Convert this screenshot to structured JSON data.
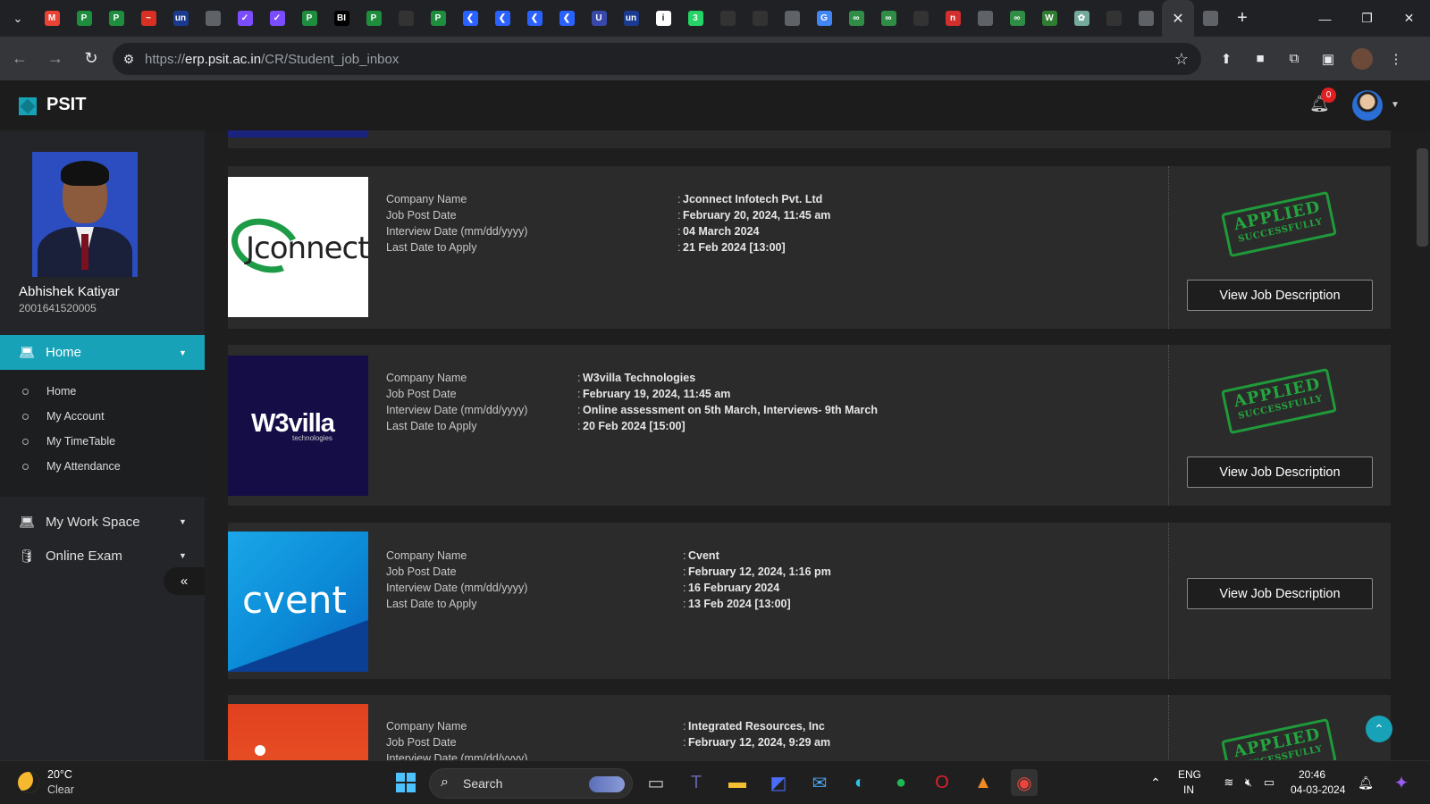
{
  "browser": {
    "tab_icons": [
      {
        "icon": "gmail-icon",
        "color": "#ea4335",
        "label": "M"
      },
      {
        "icon": "erp-icon",
        "color": "#1e8e3e",
        "label": "P"
      },
      {
        "icon": "erp-icon",
        "color": "#1e8e3e",
        "label": "P"
      },
      {
        "icon": "red-swoosh-icon",
        "color": "#d93025",
        "label": "~"
      },
      {
        "icon": "unstop-icon",
        "color": "#1a3a8f",
        "label": "un"
      },
      {
        "icon": "globe-icon",
        "color": "#5f6368",
        "label": ""
      },
      {
        "icon": "checkmark-icon",
        "color": "#7c4dff",
        "label": "✓"
      },
      {
        "icon": "checkmark-icon",
        "color": "#7c4dff",
        "label": "✓"
      },
      {
        "icon": "erp-icon",
        "color": "#1e8e3e",
        "label": "P"
      },
      {
        "icon": "bi-icon",
        "color": "#000000",
        "label": "BI"
      },
      {
        "icon": "erp-icon",
        "color": "#1e8e3e",
        "label": "P"
      },
      {
        "icon": "github-icon",
        "color": "#333333",
        "label": ""
      },
      {
        "icon": "erp-icon",
        "color": "#1e8e3e",
        "label": "P"
      },
      {
        "icon": "chevron-icon",
        "color": "#2962ff",
        "label": "❮"
      },
      {
        "icon": "chevron-icon",
        "color": "#2962ff",
        "label": "❮"
      },
      {
        "icon": "chevron-icon",
        "color": "#2962ff",
        "label": "❮"
      },
      {
        "icon": "chevron-icon",
        "color": "#2962ff",
        "label": "❮"
      },
      {
        "icon": "bucket-icon",
        "color": "#3949ab",
        "label": "U"
      },
      {
        "icon": "unstop-icon",
        "color": "#1a3a8f",
        "label": "un"
      },
      {
        "icon": "info-icon",
        "color": "#ffffff",
        "label": "i"
      },
      {
        "icon": "whatsapp-icon",
        "color": "#25d366",
        "label": "3"
      },
      {
        "icon": "github-icon",
        "color": "#333333",
        "label": ""
      },
      {
        "icon": "github-icon",
        "color": "#333333",
        "label": ""
      },
      {
        "icon": "globe-icon",
        "color": "#5f6368",
        "label": ""
      },
      {
        "icon": "google-icon",
        "color": "#4285f4",
        "label": "G"
      },
      {
        "icon": "gfg-icon",
        "color": "#2f8d46",
        "label": "∞"
      },
      {
        "icon": "gfg-icon",
        "color": "#2f8d46",
        "label": "∞"
      },
      {
        "icon": "github-icon",
        "color": "#333333",
        "label": ""
      },
      {
        "icon": "red-square-icon",
        "color": "#d32f2f",
        "label": "n"
      },
      {
        "icon": "globe-icon",
        "color": "#5f6368",
        "label": ""
      },
      {
        "icon": "gfg-icon",
        "color": "#2f8d46",
        "label": "∞"
      },
      {
        "icon": "w-icon",
        "color": "#2e7d32",
        "label": "W"
      },
      {
        "icon": "chatgpt-icon",
        "color": "#74aa9c",
        "label": "✿"
      },
      {
        "icon": "github-icon",
        "color": "#333333",
        "label": ""
      },
      {
        "icon": "globe-icon",
        "color": "#5f6368",
        "label": ""
      }
    ],
    "url_prefix": "https://",
    "url_host": "erp.psit.ac.in",
    "url_path": "/CR/Student_job_inbox"
  },
  "app": {
    "name": "PSIT",
    "notification_count": "0"
  },
  "profile": {
    "name": "Abhishek Katiyar",
    "id": "2001641520005"
  },
  "sidebar": {
    "home_label": "Home",
    "submenu": [
      "Home",
      "My Account",
      "My TimeTable",
      "My Attendance"
    ],
    "work_space_label": "My Work Space",
    "online_exam_label": "Online Exam"
  },
  "field_labels": {
    "company": "Company Name",
    "post_date": "Job Post Date",
    "interview": "Interview Date (mm/dd/yyyy)",
    "last_date": "Last Date to Apply"
  },
  "stamp": {
    "line1": "APPLIED",
    "line2": "SUCCESSFULLY"
  },
  "view_button_label": "View Job Description",
  "jobs": [
    {
      "company": "Jconnect Infotech Pvt. Ltd",
      "post_date": "February 20, 2024, 11:45 am",
      "interview": "04 March 2024",
      "last_date": "21 Feb 2024 [13:00]",
      "logo_text": "Jconnect",
      "applied": true
    },
    {
      "company": "W3villa Technologies",
      "post_date": "February 19, 2024, 11:45 am",
      "interview": "Online assessment on 5th March, Interviews- 9th March",
      "last_date": "20 Feb 2024 [15:00]",
      "logo_text": "W3villa",
      "logo_sub": "technologies",
      "applied": true
    },
    {
      "company": "Cvent",
      "post_date": "February 12, 2024, 1:16 pm",
      "interview": "16 February 2024",
      "last_date": "13 Feb 2024 [13:00]",
      "logo_text": "cvent",
      "applied": false
    },
    {
      "company": "Integrated Resources, Inc",
      "post_date": "February 12, 2024, 9:29 am",
      "applied": true
    }
  ],
  "taskbar": {
    "temperature": "20°C",
    "condition": "Clear",
    "search_placeholder": "Search",
    "lang": "ENG",
    "region": "IN",
    "time": "20:46",
    "date": "04-03-2024"
  }
}
